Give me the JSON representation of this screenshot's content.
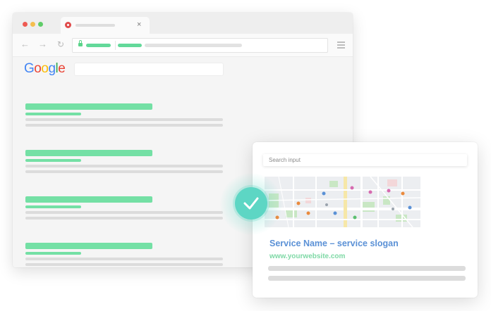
{
  "browser": {
    "tab": {
      "close_glyph": "×",
      "favicon": "shield-icon"
    },
    "toolbar": {
      "back_glyph": "←",
      "forward_glyph": "→",
      "reload_glyph": "↻"
    },
    "logo": {
      "letters": [
        {
          "char": "G",
          "color": "#4285f4"
        },
        {
          "char": "o",
          "color": "#ea4335"
        },
        {
          "char": "o",
          "color": "#fbbc05"
        },
        {
          "char": "g",
          "color": "#4285f4"
        },
        {
          "char": "l",
          "color": "#34a853"
        },
        {
          "char": "e",
          "color": "#ea4335"
        }
      ]
    },
    "results_count": 4
  },
  "card": {
    "search_placeholder": "Search input",
    "service_title": "Service Name – service slogan",
    "service_url": "www.yourwebsite.com"
  },
  "colors": {
    "accent_green": "#74e0a5",
    "check_teal": "#5dd6c4",
    "title_blue": "#5b91d6",
    "url_green": "#7fd9a6"
  }
}
